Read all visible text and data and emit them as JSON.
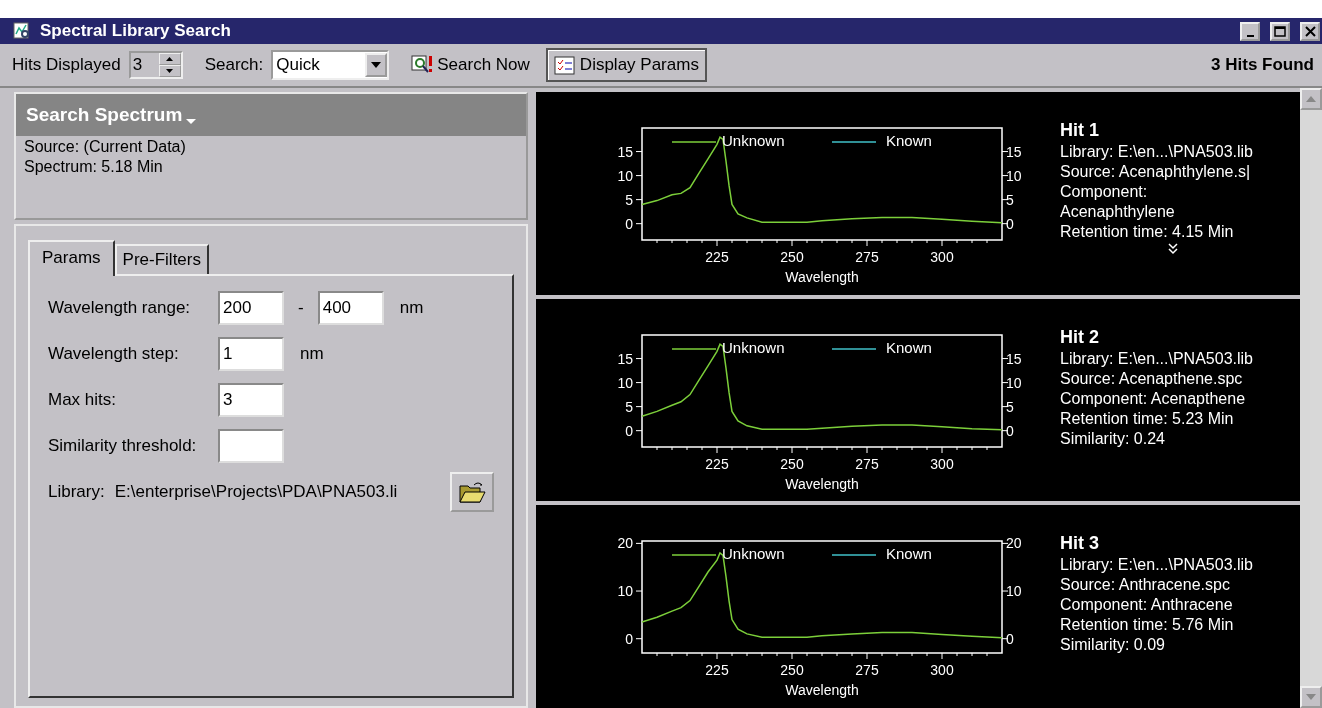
{
  "window": {
    "title": "Spectral Library Search"
  },
  "toolbar": {
    "hits_label": "Hits Displayed",
    "hits_value": "3",
    "search_label": "Search:",
    "search_value": "Quick",
    "buttons": [
      {
        "label": "Search Now",
        "kind": "search",
        "pressed": false
      },
      {
        "label": "Display Params",
        "kind": "params",
        "pressed": true
      }
    ],
    "status": "3 Hits Found"
  },
  "search_spectrum": {
    "title": "Search Spectrum",
    "lines": [
      "Source: (Current Data)",
      "Spectrum: 5.18 Min"
    ]
  },
  "tabs": [
    {
      "label": "Params",
      "selected": true
    },
    {
      "label": "Pre-Filters",
      "selected": false
    }
  ],
  "params": [
    {
      "label": "Wavelength range:",
      "values": [
        "200",
        "400"
      ],
      "separator": "-",
      "unit": "nm"
    },
    {
      "label": "Wavelength step:",
      "values": [
        "1"
      ],
      "unit": "nm"
    },
    {
      "label": "Max hits:",
      "values": [
        "3"
      ]
    },
    {
      "label": "Similarity threshold:"
    }
  ],
  "library": {
    "label": "Library:",
    "path": "E:\\enterprise\\Projects\\PDA\\PNA503.li"
  },
  "hits": [
    {
      "title": "Hit 1",
      "lines": [
        "Library: E:\\en...\\PNA503.lib",
        "Source: Acenaphthylene.s|",
        "Component:",
        "Acenaphthylene",
        "Retention time: 4.15 Min"
      ],
      "expandable": true,
      "chart_data": {
        "type": "line",
        "xlabel": "Wavelength",
        "xlim": [
          200,
          320
        ],
        "ylim": [
          -3.4,
          19.9
        ],
        "y2lim": [
          -3.4,
          19.9
        ],
        "xticks": [
          225,
          250,
          275,
          300
        ],
        "yticks": [
          0,
          5,
          10,
          15
        ],
        "y2ticks": [
          0,
          5,
          10,
          15
        ],
        "x": [
          200,
          205,
          210,
          213,
          216,
          219,
          222,
          225,
          226,
          227,
          228,
          229,
          230,
          232,
          235,
          240,
          250,
          255,
          260,
          270,
          280,
          290,
          300,
          310,
          320
        ],
        "series": [
          {
            "name": "Unknown",
            "color": "#7ccf3a",
            "values": [
              4,
              4.8,
              6,
              6.3,
              7.5,
              10.5,
              13.5,
              16.5,
              18,
              17.5,
              13,
              8,
              4,
              2,
              1.2,
              0.3,
              0.3,
              0.3,
              0.6,
              1,
              1.3,
              1.3,
              0.9,
              0.5,
              0.2
            ]
          },
          {
            "name": "Known",
            "color": "#40c0c8",
            "values": [
              null,
              null,
              null,
              null,
              null,
              null,
              null,
              null,
              null,
              null,
              null,
              null,
              null,
              null,
              null,
              null,
              null,
              null,
              null,
              null,
              null,
              null,
              null,
              null,
              null
            ]
          }
        ]
      }
    },
    {
      "title": "Hit 2",
      "lines": [
        "Library: E:\\en...\\PNA503.lib",
        "Source: Acenapthene.spc",
        "Component: Acenapthene",
        "Retention time: 5.23 Min",
        "Similarity: 0.24"
      ],
      "expandable": false,
      "chart_data": {
        "type": "line",
        "xlabel": "Wavelength",
        "xlim": [
          200,
          320
        ],
        "ylim": [
          -3.4,
          19.9
        ],
        "y2lim": [
          -3.4,
          19.9
        ],
        "xticks": [
          225,
          250,
          275,
          300
        ],
        "yticks": [
          0,
          5,
          10,
          15
        ],
        "y2ticks": [
          0,
          5,
          10,
          15
        ],
        "x": [
          200,
          205,
          210,
          213,
          216,
          219,
          222,
          225,
          226,
          227,
          228,
          229,
          230,
          232,
          235,
          240,
          250,
          255,
          260,
          270,
          280,
          290,
          300,
          310,
          320
        ],
        "series": [
          {
            "name": "Unknown",
            "color": "#7ccf3a",
            "values": [
              3,
              4,
              5.3,
              6,
              7.5,
              10.5,
              13.5,
              16.5,
              18,
              17.5,
              13,
              8,
              4,
              2,
              1,
              0.3,
              0.3,
              0.3,
              0.5,
              0.9,
              1.2,
              1.2,
              0.8,
              0.4,
              0.2
            ]
          },
          {
            "name": "Known",
            "color": "#40c0c8",
            "values": [
              null,
              null,
              null,
              null,
              null,
              null,
              null,
              null,
              null,
              null,
              null,
              null,
              null,
              null,
              null,
              null,
              null,
              null,
              null,
              null,
              null,
              null,
              null,
              null,
              null
            ]
          }
        ]
      }
    },
    {
      "title": "Hit 3",
      "lines": [
        "Library: E:\\en...\\PNA503.lib",
        "Source: Anthracene.spc",
        "Component: Anthracene",
        "Retention time: 5.76 Min",
        "Similarity: 0.09"
      ],
      "expandable": false,
      "chart_data": {
        "type": "line",
        "xlabel": "Wavelength",
        "xlim": [
          200,
          320
        ],
        "ylim": [
          -3,
          20.5
        ],
        "xticks": [
          225,
          250,
          275,
          300
        ],
        "yticks": [
          0,
          10,
          20
        ],
        "y2lim": [
          -3,
          20.5
        ],
        "y2ticks": [
          0,
          10,
          20
        ],
        "x": [
          200,
          205,
          210,
          213,
          216,
          219,
          222,
          225,
          226,
          227,
          228,
          229,
          230,
          232,
          235,
          240,
          250,
          255,
          260,
          270,
          280,
          290,
          300,
          310,
          320
        ],
        "series": [
          {
            "name": "Unknown",
            "color": "#7ccf3a",
            "values": [
              3.5,
              4.5,
              5.8,
              6.5,
              8,
              11,
              14,
              16.5,
              18,
              17.5,
              13,
              8,
              4,
              2,
              1,
              0.3,
              0.3,
              0.3,
              0.6,
              1,
              1.3,
              1.3,
              0.9,
              0.5,
              0.2
            ]
          },
          {
            "name": "Known",
            "color": "#40c0c8",
            "values": [
              null,
              null,
              null,
              null,
              null,
              null,
              null,
              null,
              null,
              null,
              null,
              null,
              null,
              null,
              null,
              null,
              null,
              null,
              null,
              null,
              null,
              null,
              null,
              null,
              null
            ]
          }
        ]
      }
    }
  ]
}
